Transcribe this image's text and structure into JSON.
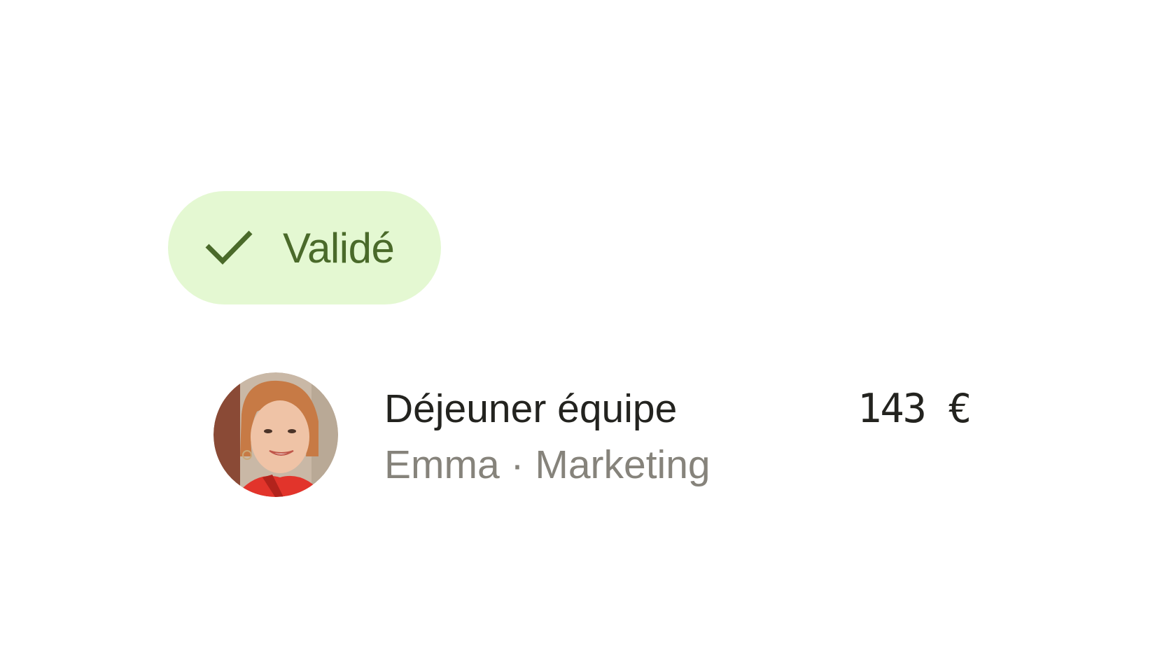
{
  "status": {
    "label": "Validé",
    "icon": "check-icon",
    "background": "#e4f8d2",
    "color": "#4a6a2a"
  },
  "expense": {
    "title": "Déjeuner équipe",
    "subtitle": "Emma · Marketing",
    "amount": "143 €"
  }
}
